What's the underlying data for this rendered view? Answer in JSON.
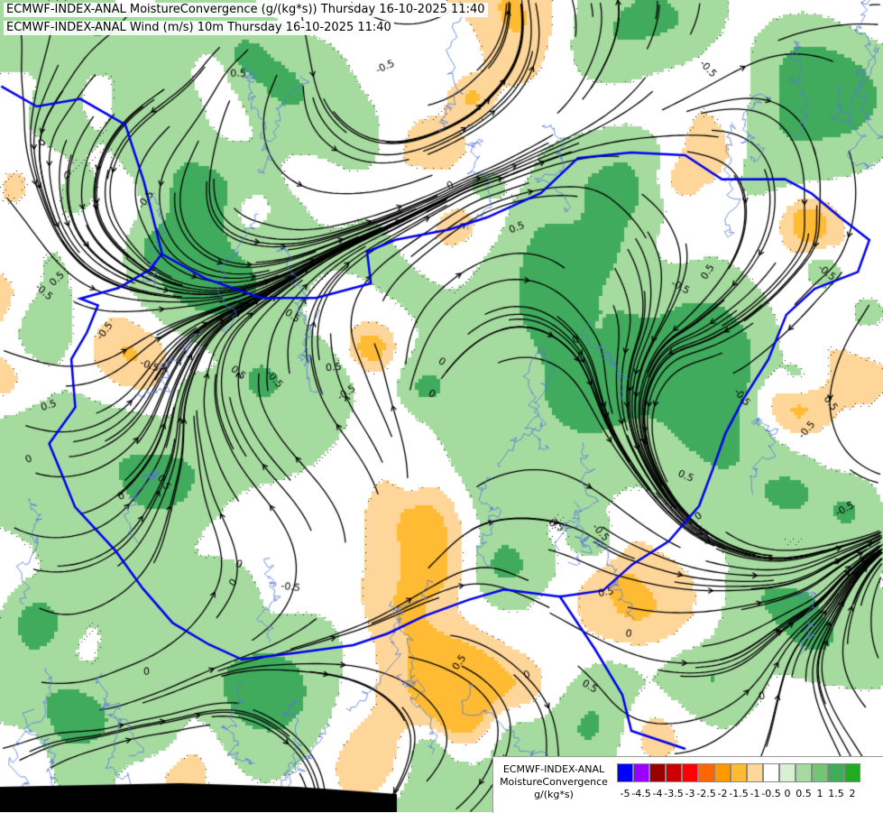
{
  "titles": {
    "line1": "ECMWF-INDEX-ANAL MoistureConvergence (g/(kg*s)) Thursday 16-10-2025 11:40",
    "line2": "ECMWF-INDEX-ANAL Wind (m/s) 10m Thursday 16-10-2025 11:40"
  },
  "legend": {
    "model": "ECMWF-INDEX-ANAL",
    "parameter": "MoistureConvergence",
    "unit": "g/(kg*s)",
    "colors": [
      "#0000ff",
      "#9900ff",
      "#990000",
      "#cc0000",
      "#ff0000",
      "#ff6600",
      "#ff9900",
      "#ffbb33",
      "#ffd699",
      "#ffffff",
      "#d9f0d3",
      "#a6dba0",
      "#74c476",
      "#41ab5d",
      "#22aa22"
    ],
    "tick_labels": [
      "-5",
      "-4.5",
      "-4",
      "-3.5",
      "-3",
      "-2.5",
      "-2",
      "-1.5",
      "-1",
      "-0.5",
      "0",
      "0.5",
      "1",
      "1.5",
      "2"
    ]
  },
  "contour_labels": [
    "0.5",
    "-0.5",
    "0"
  ],
  "layers": {
    "background": "white",
    "convergence_positive_color": "#a6dba0",
    "convergence_strong_color": "#41ab5d",
    "divergence_color": "#ffd699",
    "divergence_strong_color": "#ffbb33",
    "border_color": "#0000ee",
    "river_color": "#5577dd",
    "streamline_color": "#000000",
    "land_outside_color": "#000000"
  }
}
